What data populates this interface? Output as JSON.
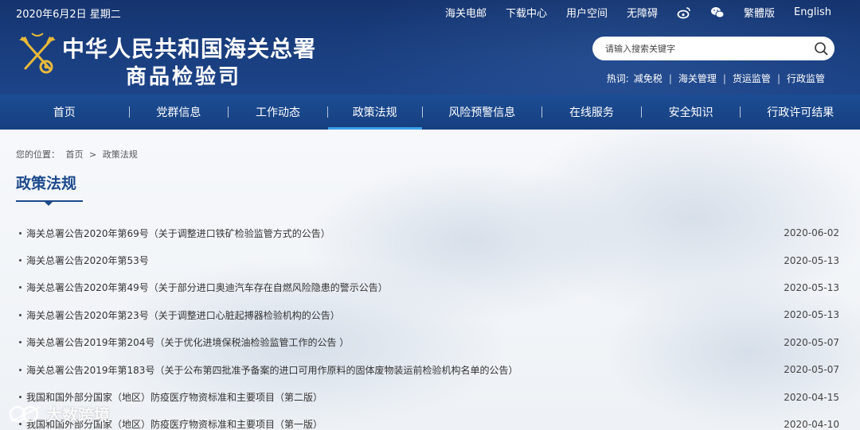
{
  "header": {
    "date": "2020年6月2日 星期二",
    "top_links": [
      "海关电邮",
      "下载中心",
      "用户空间",
      "无障碍"
    ],
    "social_icons": [
      "weibo-icon",
      "wechat-icon"
    ],
    "lang_links": [
      "繁體版",
      "English"
    ],
    "title_line1": "中华人民共和国海关总署",
    "title_line2": "商品检验司",
    "search_placeholder": "请输入搜索关键字",
    "hot_label": "热词:",
    "hot_words": [
      "减免税",
      "海关管理",
      "货运监管",
      "行政监管"
    ]
  },
  "nav": {
    "items": [
      "首页",
      "党群信息",
      "工作动态",
      "政策法规",
      "风险预警信息",
      "在线服务",
      "安全知识",
      "行政许可结果"
    ],
    "active": "政策法规"
  },
  "breadcrumb": {
    "prefix": "您的位置：",
    "home": "首页",
    "sep": ">",
    "current": "政策法规"
  },
  "page_title": "政策法规",
  "articles": [
    {
      "title": "海关总署公告2020年第69号（关于调整进口铁矿检验监管方式的公告）",
      "date": "2020-06-02"
    },
    {
      "title": "海关总署公告2020年第53号",
      "date": "2020-05-13"
    },
    {
      "title": "海关总署公告2020年第49号（关于部分进口奥迪汽车存在自燃风险隐患的警示公告）",
      "date": "2020-05-13"
    },
    {
      "title": "海关总署公告2020年第23号（关于调整进口心脏起搏器检验机构的公告）",
      "date": "2020-05-13"
    },
    {
      "title": "海关总署公告2019年第204号（关于优化进境保税油检验监管工作的公告 ）",
      "date": "2020-05-07"
    },
    {
      "title": "海关总署公告2019年第183号（关于公布第四批准予备案的进口可用作原料的固体废物装运前检验机构名单的公告）",
      "date": "2020-05-07"
    },
    {
      "title": "我国和国外部分国家（地区）防疫医疗物资标准和主要项目（第二版）",
      "date": "2020-04-15"
    },
    {
      "title": "我国和国外部分国家（地区）防疫医疗物资标准和主要项目（第一版）",
      "date": "2020-04-10"
    }
  ],
  "watermark": "大数跨境",
  "colors": {
    "header_bg": "#1a3f80",
    "nav_bg": "#1c4d94",
    "active_underline": "#3aa0e8",
    "title_blue": "#1d4a8c"
  }
}
